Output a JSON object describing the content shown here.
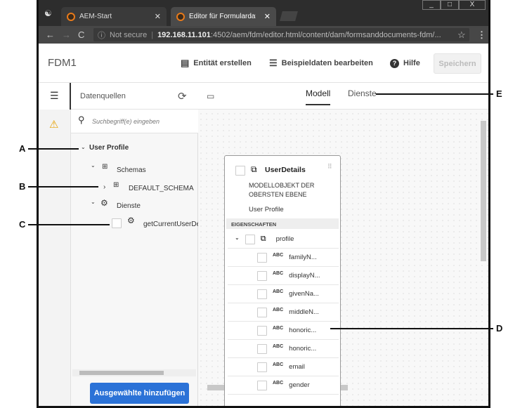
{
  "browser": {
    "tabs": [
      {
        "label": "AEM-Start"
      },
      {
        "label": "Editor für Formulardatenmo"
      }
    ],
    "url_warning": "Not secure",
    "url_host": "192.168.11.101",
    "url_path": ":4502/aem/fdm/editor.html/content/dam/formsanddocuments-fdm/..."
  },
  "app": {
    "title": "FDM1",
    "actions": {
      "create_entity": "Entität erstellen",
      "edit_sample": "Beispieldaten bearbeiten",
      "help": "Hilfe",
      "save": "Speichern"
    }
  },
  "panel": {
    "title": "Datenquellen",
    "search_placeholder": "Suchbegriff(e) eingeben",
    "tree": {
      "root": "User Profile",
      "schemas": "Schemas",
      "schema": "DEFAULT_SCHEMA",
      "services": "Dienste",
      "service": "getCurrentUserDet"
    },
    "add_button": "Ausgewählte hinzufügen"
  },
  "canvas": {
    "tabs": [
      "Modell",
      "Dienste"
    ],
    "card": {
      "title": "UserDetails",
      "type": "MODELLOBJEKT DER OBERSTEN EBENE",
      "source": "User Profile",
      "section": "EIGENSCHAFTEN",
      "group": "profile",
      "type_badge": "ABC",
      "properties": [
        "familyN...",
        "displayN...",
        "givenNa...",
        "middleN...",
        "honoric...",
        "honoric...",
        "email",
        "gender"
      ]
    }
  },
  "callouts": [
    "A",
    "B",
    "C",
    "D",
    "E"
  ]
}
